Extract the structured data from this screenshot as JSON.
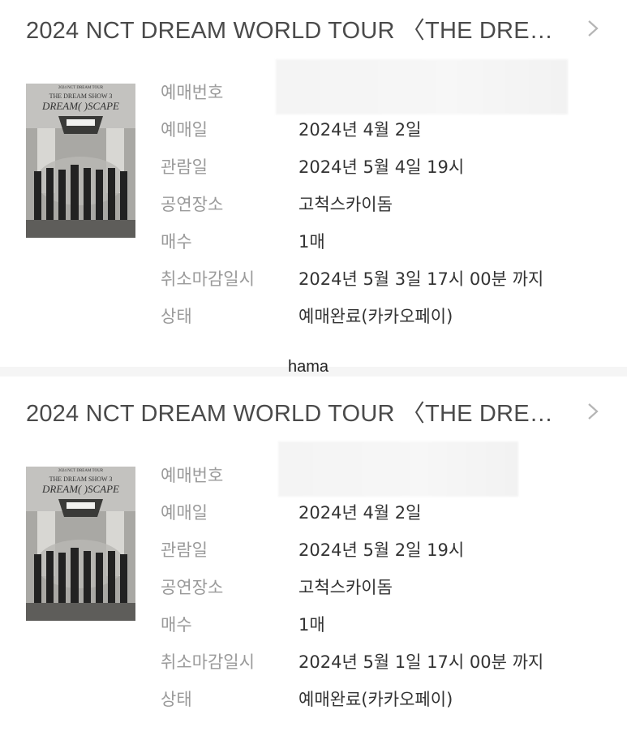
{
  "tickets": [
    {
      "title": "2024 NCT DREAM WORLD TOUR 〈THE DRE…",
      "poster": {
        "line1": "2024 NCT DREAM TOUR",
        "line2": "THE DREAM SHOW 3",
        "line3": "DREAM( )SCAPE"
      },
      "rows": [
        {
          "label": "예매번호",
          "value": ""
        },
        {
          "label": "예매일",
          "value": "2024년 4월 2일"
        },
        {
          "label": "관람일",
          "value": "2024년 5월 4일 19시"
        },
        {
          "label": "공연장소",
          "value": "고척스카이돔"
        },
        {
          "label": "매수",
          "value": "1매"
        },
        {
          "label": "취소마감일시",
          "value": "2024년 5월 3일 17시 00분 까지"
        },
        {
          "label": "상태",
          "value": "예매완료(카카오페이)"
        }
      ]
    },
    {
      "title": "2024 NCT DREAM WORLD TOUR 〈THE DRE…",
      "poster": {
        "line1": "2024 NCT DREAM TOUR",
        "line2": "THE DREAM SHOW 3",
        "line3": "DREAM( )SCAPE"
      },
      "rows": [
        {
          "label": "예매번호",
          "value": ""
        },
        {
          "label": "예매일",
          "value": "2024년 4월 2일"
        },
        {
          "label": "관람일",
          "value": "2024년 5월 2일 19시"
        },
        {
          "label": "공연장소",
          "value": "고척스카이돔"
        },
        {
          "label": "매수",
          "value": "1매"
        },
        {
          "label": "취소마감일시",
          "value": "2024년 5월 1일 17시 00분 까지"
        },
        {
          "label": "상태",
          "value": "예매완료(카카오페이)"
        }
      ]
    }
  ],
  "watermark": "hama",
  "icons": {
    "chevron": "chevron-right-icon"
  }
}
